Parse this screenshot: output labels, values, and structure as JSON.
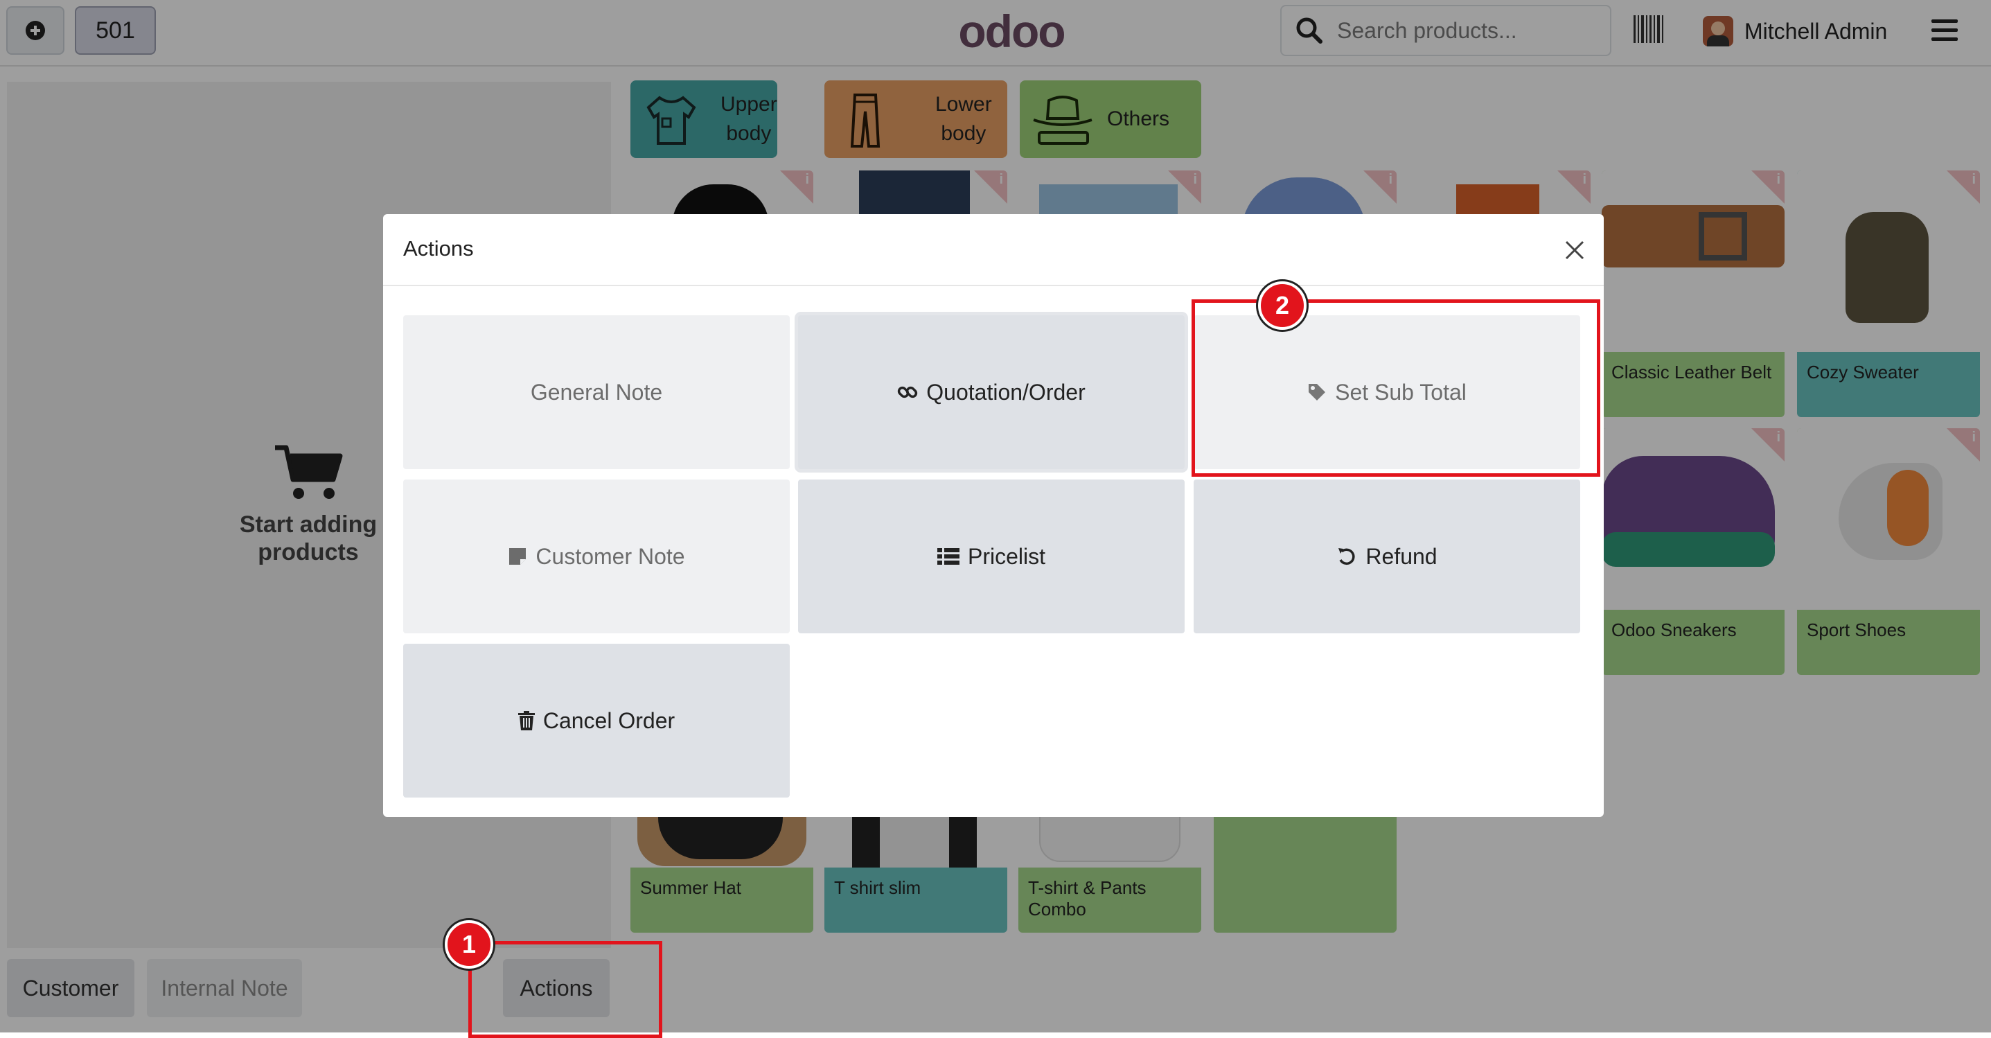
{
  "header": {
    "order_number": "501",
    "logo_text": "odoo",
    "search_placeholder": "Search products...",
    "user_name": "Mitchell Admin"
  },
  "categories": [
    {
      "label_line1": "Upper",
      "label_line2": "body",
      "color": "#48a9a6"
    },
    {
      "label_line1": "Lower",
      "label_line2": "body",
      "color": "#e8a165"
    },
    {
      "label_line1": "Others",
      "label_line2": "",
      "color": "#9ed27a"
    }
  ],
  "products": {
    "classic_belt": "Classic Leather Belt",
    "cozy_sweater": "Cozy Sweater",
    "odoo_sneakers": "Odoo Sneakers",
    "sport_shoes": "Sport Shoes",
    "summer_hat": "Summer Hat",
    "tshirt_slim": "T shirt slim",
    "tshirt_combo": "T-shirt & Pants Combo"
  },
  "cart": {
    "empty_line1": "Start adding",
    "empty_line2": "products"
  },
  "controls": {
    "customer": "Customer",
    "internal_note": "Internal Note",
    "actions": "Actions"
  },
  "modal": {
    "title": "Actions",
    "buttons": {
      "general_note": "General Note",
      "quotation": "Quotation/Order",
      "set_sub_total": "Set Sub Total",
      "customer_note": "Customer Note",
      "pricelist": "Pricelist",
      "refund": "Refund",
      "cancel_order": "Cancel Order"
    }
  },
  "annotations": {
    "step1": "1",
    "step2": "2",
    "highlight_color": "#e2141c"
  }
}
